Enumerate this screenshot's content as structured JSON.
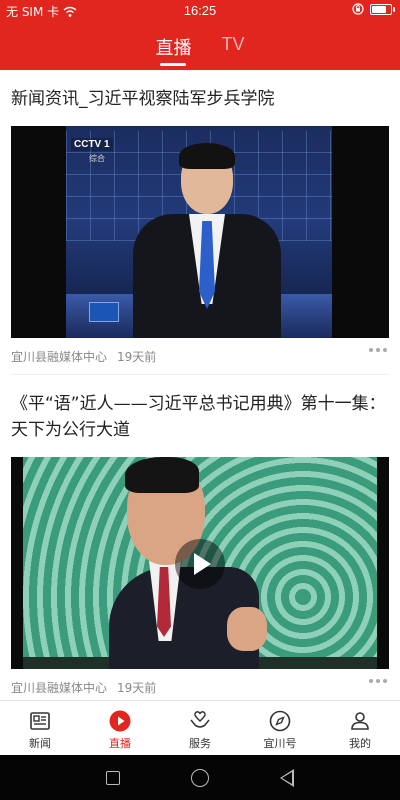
{
  "status_bar": {
    "carrier": "无 SIM 卡",
    "time": "16:25",
    "battery_level": 0.85
  },
  "header": {
    "tabs": [
      {
        "label": "直播",
        "active": true
      },
      {
        "label": "TV",
        "active": false
      }
    ],
    "accent_color": "#e0261f"
  },
  "feed": {
    "items": [
      {
        "title": "新闻资讯_习近平视察陆军步兵学院",
        "source": "宜川县融媒体中心",
        "time": "19天前",
        "video_overlay": {
          "channel": "CCTV 1",
          "channel_sub": "综合"
        },
        "thumbnail": "news-anchor-studio"
      },
      {
        "title": "《平“语”近人——习近平总书记用典》第十一集：天下为公行大道",
        "source": "宜川县融媒体中心",
        "time": "19天前",
        "thumbnail": "speaker-green-background",
        "has_play_button": true
      }
    ]
  },
  "bottom_nav": {
    "items": [
      {
        "label": "新闻",
        "icon": "newspaper-icon",
        "active": false
      },
      {
        "label": "直播",
        "icon": "play-circle-icon",
        "active": true
      },
      {
        "label": "服务",
        "icon": "heart-hands-icon",
        "active": false
      },
      {
        "label": "宜川号",
        "icon": "compass-icon",
        "active": false
      },
      {
        "label": "我的",
        "icon": "user-icon",
        "active": false
      }
    ]
  },
  "system_nav": {
    "buttons": [
      "recents-square-icon",
      "home-circle-icon",
      "back-triangle-icon"
    ]
  }
}
